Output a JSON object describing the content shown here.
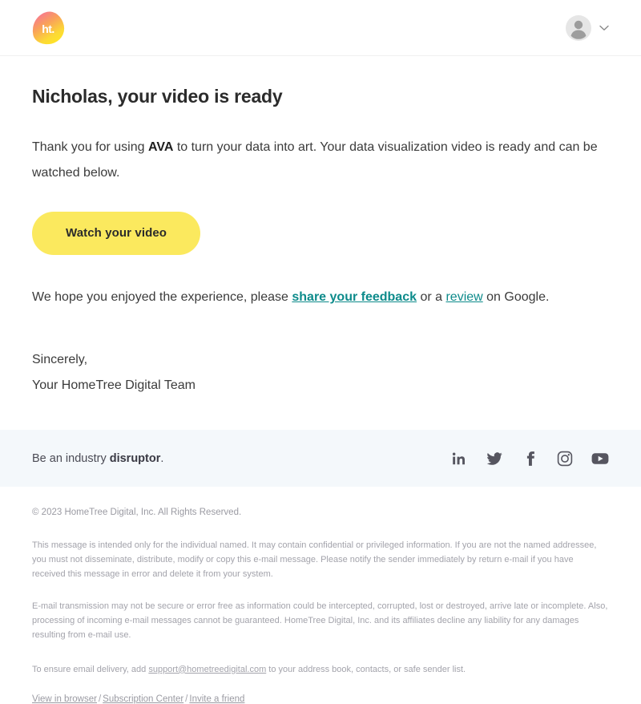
{
  "header": {
    "logo_text": "ht.",
    "logo_name": "hometree-logo",
    "avatar_icon": "user-avatar-icon",
    "chevron_icon": "chevron-down-icon"
  },
  "main": {
    "title": "Nicholas, your video is ready",
    "intro_before": "Thank you for using ",
    "intro_bold": "AVA",
    "intro_after": " to turn your data into art. Your data visualization video is ready and can be watched below.",
    "cta_label": "Watch your video",
    "feedback_before": "We hope you enjoyed the experience, please ",
    "feedback_link1": "share your feedback",
    "feedback_middle": " or a ",
    "feedback_link2": "review",
    "feedback_after": " on Google.",
    "signoff_line1": "Sincerely,",
    "signoff_line2": "Your HomeTree Digital Team"
  },
  "band": {
    "text_before": "Be an industry ",
    "text_bold": "disruptor",
    "text_after": ".",
    "socials": [
      {
        "name": "linkedin-icon",
        "label": "in"
      },
      {
        "name": "twitter-icon",
        "label": "Twitter"
      },
      {
        "name": "facebook-icon",
        "label": "f"
      },
      {
        "name": "instagram-icon",
        "label": "Instagram"
      },
      {
        "name": "youtube-icon",
        "label": "YouTube"
      }
    ]
  },
  "legal": {
    "copyright": "© 2023 HomeTree Digital, Inc. All Rights Reserved.",
    "paragraph1": "This message is intended only for the individual named. It may contain confidential or privileged information. If you are not the named addressee, you must not disseminate, distribute, modify or copy this e-mail message. Please notify the sender immediately by return e-mail if you have received this message in error and delete it from your system.",
    "paragraph2": "E-mail transmission may not be secure or error free as information could be intercepted, corrupted, lost or destroyed, arrive late or incomplete. Also, processing of incoming e-mail messages cannot be guaranteed. HomeTree Digital, Inc. and its affiliates decline any liability for any damages resulting from e-mail use.",
    "deliver_before": "To ensure email delivery, add ",
    "deliver_email": "support@hometreedigital.com",
    "deliver_after": " to your address book, contacts, or safe sender list.",
    "link_view_in_browser": "View in browser",
    "link_subscription_center": "Subscription Center",
    "link_invite_a_friend": "Invite a friend",
    "separator": "/"
  },
  "colors": {
    "cta_yellow": "#fbe95e",
    "link_teal": "#0d8b8b",
    "band_background": "#f4f8fb",
    "logo_gradient_start": "#f76da0",
    "logo_gradient_end": "#ffe81f"
  }
}
